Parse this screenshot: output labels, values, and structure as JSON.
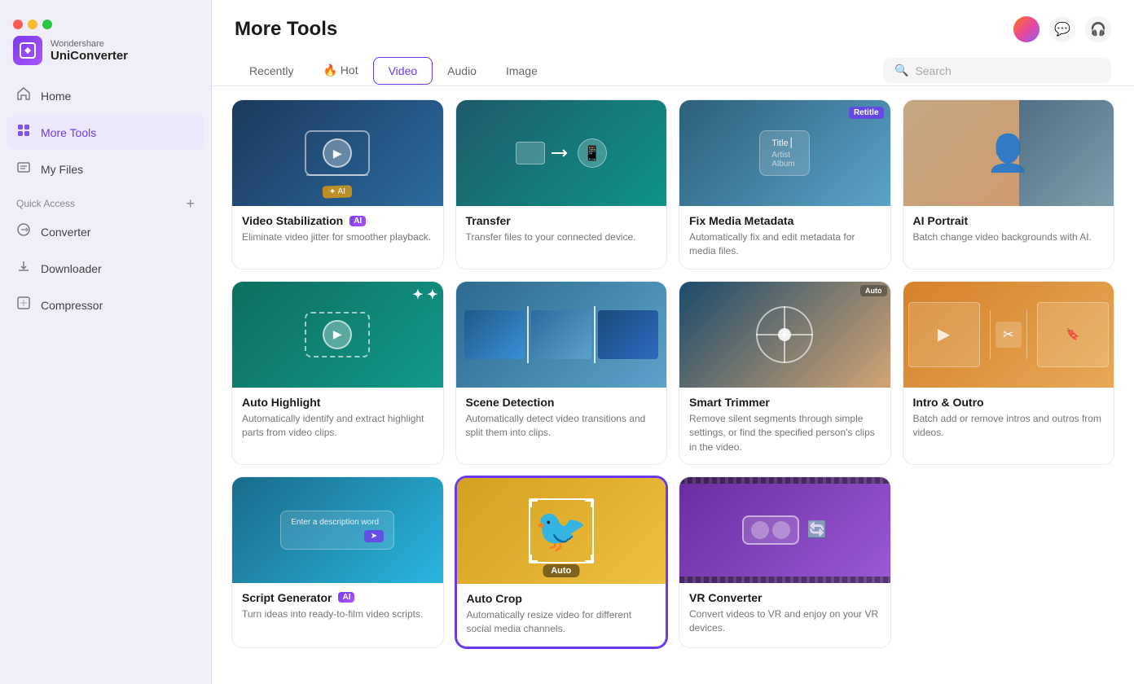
{
  "app": {
    "brand": "Wondershare",
    "title": "UniConverter",
    "logo_alt": "UniConverter logo"
  },
  "traffic_lights": [
    "red",
    "yellow",
    "green"
  ],
  "sidebar": {
    "items": [
      {
        "id": "home",
        "label": "Home",
        "icon": "⌂",
        "active": false
      },
      {
        "id": "more-tools",
        "label": "More Tools",
        "icon": "⊞",
        "active": true
      },
      {
        "id": "my-files",
        "label": "My Files",
        "icon": "☰",
        "active": false
      }
    ],
    "quick_access_label": "Quick Access",
    "quick_access_items": [
      {
        "id": "converter",
        "label": "Converter",
        "icon": "↔"
      },
      {
        "id": "downloader",
        "label": "Downloader",
        "icon": "⬇"
      },
      {
        "id": "compressor",
        "label": "Compressor",
        "icon": "⊡"
      }
    ]
  },
  "header": {
    "page_title": "More Tools",
    "tabs": [
      {
        "id": "recently",
        "label": "Recently",
        "emoji": "",
        "active": false
      },
      {
        "id": "hot",
        "label": "Hot",
        "emoji": "🔥",
        "active": false
      },
      {
        "id": "video",
        "label": "Video",
        "emoji": "",
        "active": true
      },
      {
        "id": "audio",
        "label": "Audio",
        "emoji": "",
        "active": false
      },
      {
        "id": "image",
        "label": "Image",
        "emoji": "",
        "active": false
      }
    ],
    "search_placeholder": "Search"
  },
  "tools": [
    {
      "id": "video-stabilization",
      "title": "Video Stabilization",
      "ai": true,
      "description": "Eliminate video jitter for smoother playback.",
      "thumb_class": "thumb-stabilization",
      "selected": false
    },
    {
      "id": "transfer",
      "title": "Transfer",
      "ai": false,
      "description": "Transfer files to your connected device.",
      "thumb_class": "thumb-transfer",
      "selected": false
    },
    {
      "id": "fix-media-metadata",
      "title": "Fix Media Metadata",
      "ai": false,
      "description": "Automatically fix and edit metadata for media files.",
      "thumb_class": "thumb-fixmeta",
      "selected": false
    },
    {
      "id": "ai-portrait",
      "title": "AI Portrait",
      "ai": false,
      "description": "Batch change video backgrounds with AI.",
      "thumb_class": "thumb-aiportrait",
      "selected": false
    },
    {
      "id": "auto-highlight",
      "title": "Auto Highlight",
      "ai": false,
      "description": "Automatically identify and extract highlight parts from video clips.",
      "thumb_class": "thumb-autohighlight",
      "selected": false
    },
    {
      "id": "scene-detection",
      "title": "Scene Detection",
      "ai": false,
      "description": "Automatically detect video transitions and split them into clips.",
      "thumb_class": "thumb-scenedetect",
      "selected": false
    },
    {
      "id": "smart-trimmer",
      "title": "Smart Trimmer",
      "ai": false,
      "description": "Remove silent segments through simple settings, or find the specified person's clips in the video.",
      "thumb_class": "thumb-smarttrimmer",
      "selected": false
    },
    {
      "id": "intro-outro",
      "title": "Intro & Outro",
      "ai": false,
      "description": "Batch add or remove intros and outros from videos.",
      "thumb_class": "thumb-introoutro",
      "selected": false
    },
    {
      "id": "script-generator",
      "title": "Script Generator",
      "ai": true,
      "description": "Turn ideas into ready-to-film video scripts.",
      "thumb_class": "thumb-scriptgen",
      "selected": false
    },
    {
      "id": "auto-crop",
      "title": "Auto Crop",
      "ai": false,
      "description": "Automatically resize video for different social media channels.",
      "thumb_class": "thumb-autocrop",
      "selected": true
    },
    {
      "id": "vr-converter",
      "title": "VR Converter",
      "ai": false,
      "description": "Convert videos to VR and enjoy on your VR devices.",
      "thumb_class": "thumb-vrconverter",
      "selected": false
    }
  ]
}
